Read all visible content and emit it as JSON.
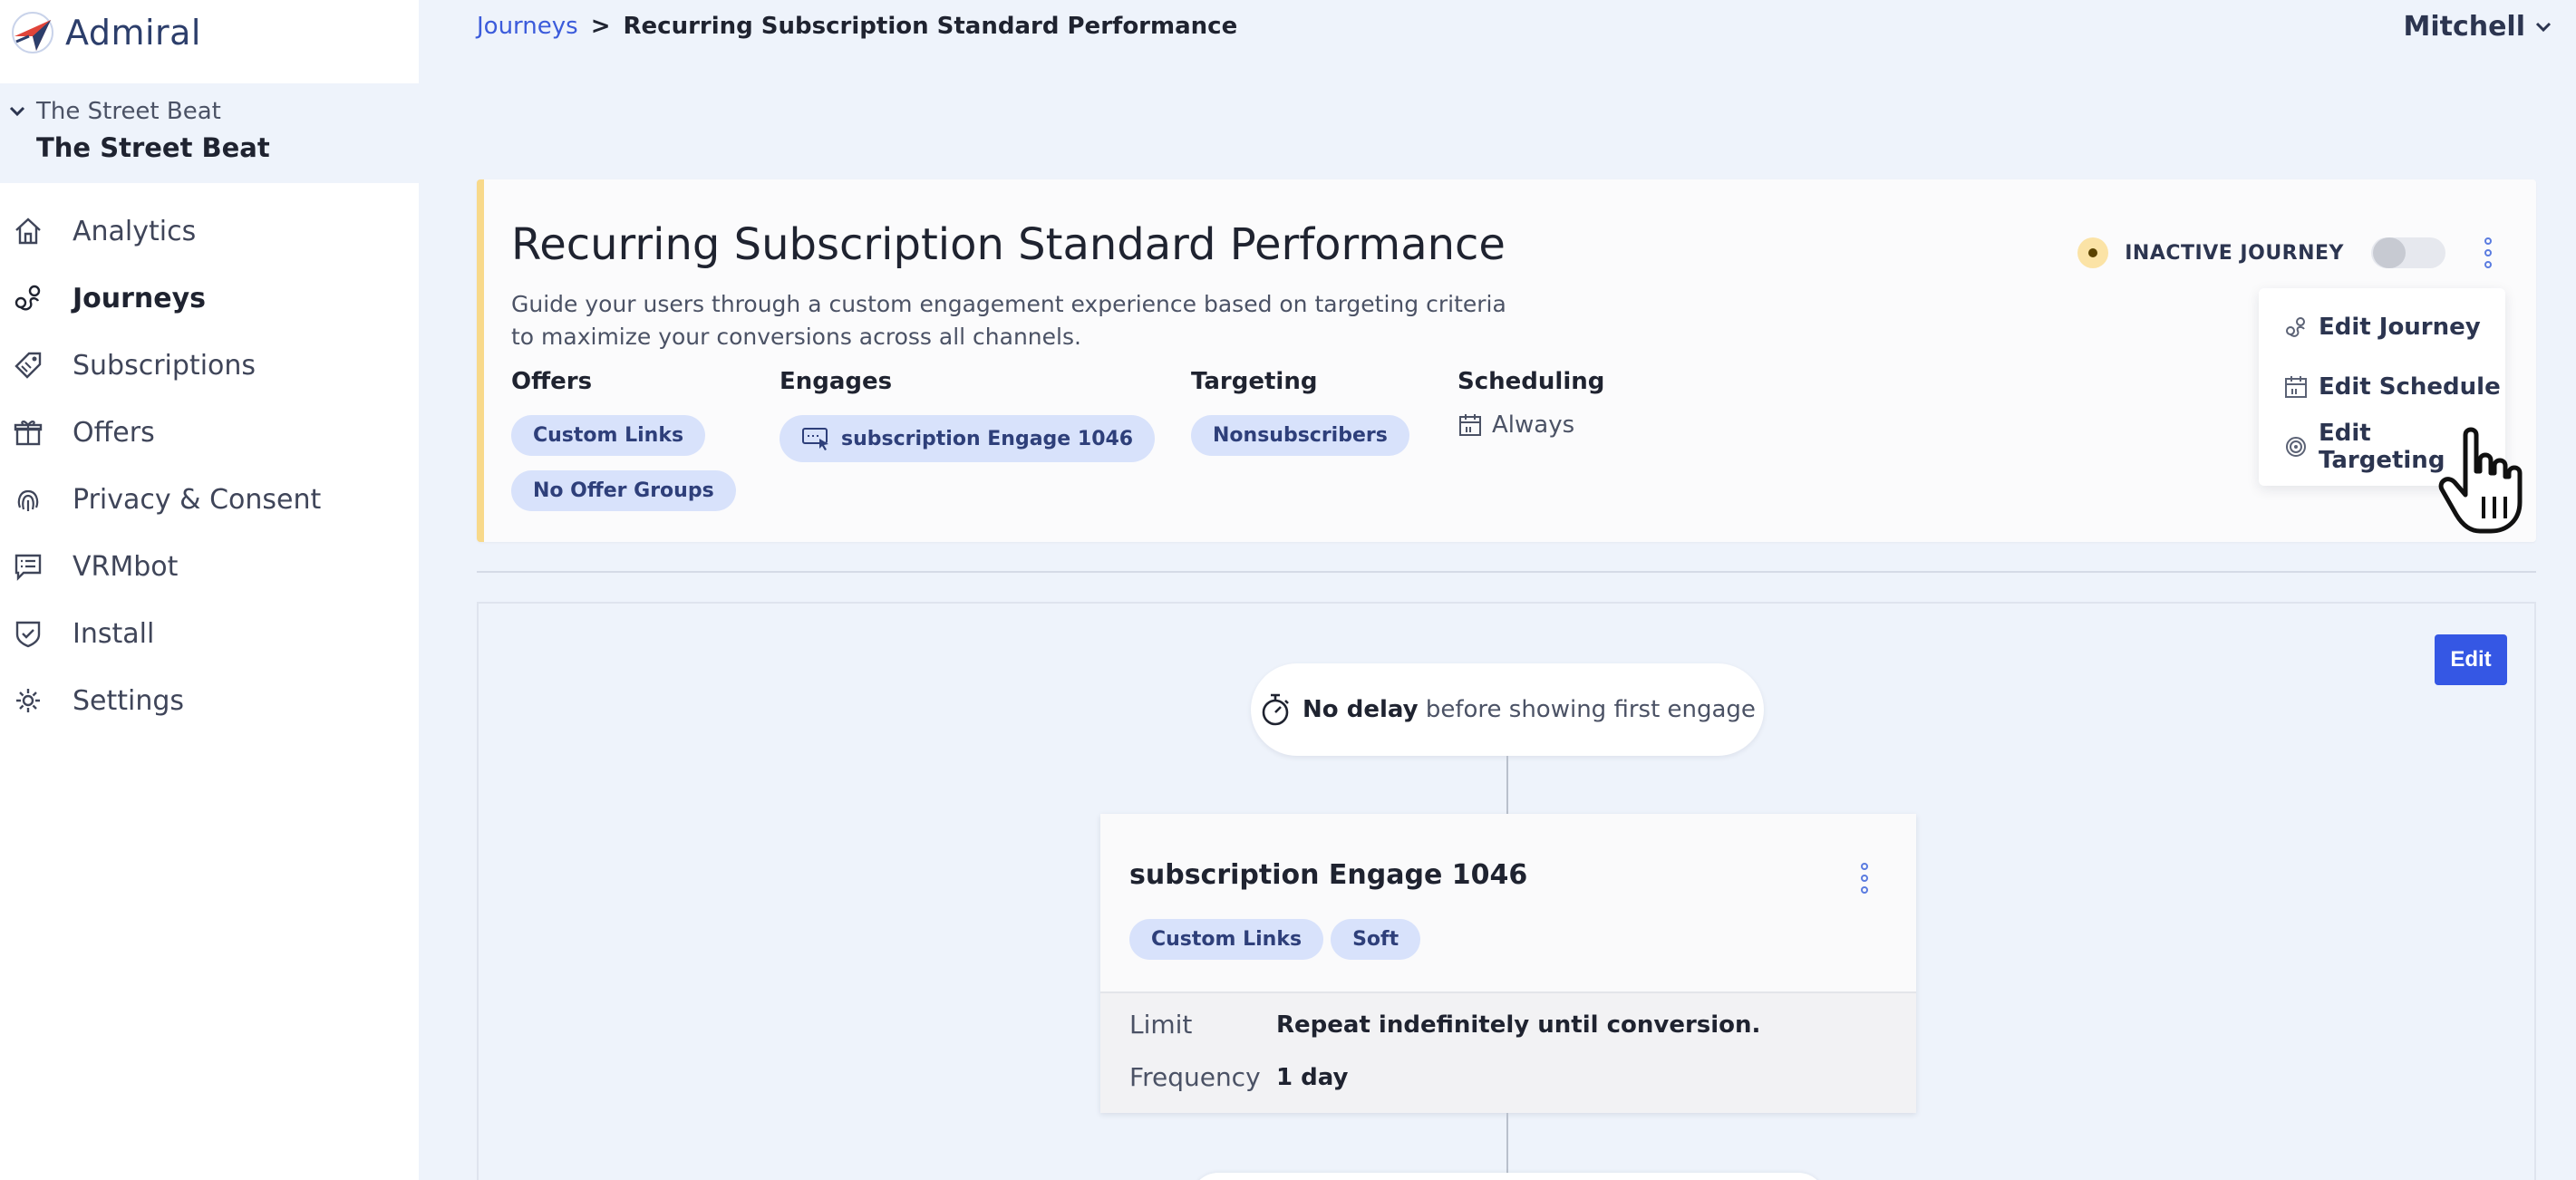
{
  "app": {
    "name": "Admiral"
  },
  "org": {
    "parent": "The Street Beat",
    "current": "The Street Beat"
  },
  "nav": [
    {
      "label": "Analytics",
      "icon": "home-icon"
    },
    {
      "label": "Journeys",
      "icon": "journey-icon",
      "active": true
    },
    {
      "label": "Subscriptions",
      "icon": "tag-icon"
    },
    {
      "label": "Offers",
      "icon": "gift-icon"
    },
    {
      "label": "Privacy & Consent",
      "icon": "fingerprint-icon"
    },
    {
      "label": "VRMbot",
      "icon": "chat-icon"
    },
    {
      "label": "Install",
      "icon": "shield-check-icon"
    },
    {
      "label": "Settings",
      "icon": "gear-icon"
    }
  ],
  "breadcrumb": {
    "parent": "Journeys",
    "separator": ">",
    "current": "Recurring Subscription Standard Performance"
  },
  "user": {
    "name": "Mitchell"
  },
  "journey": {
    "title": "Recurring Subscription Standard Performance",
    "description": "Guide your users through a custom engagement experience based on targeting criteria to maximize your conversions across all channels.",
    "status": "INACTIVE JOURNEY",
    "active": false,
    "offers": {
      "label": "Offers",
      "chips": [
        "Custom Links",
        "No Offer Groups"
      ]
    },
    "engages": {
      "label": "Engages",
      "chips": [
        "subscription Engage 1046"
      ]
    },
    "targeting": {
      "label": "Targeting",
      "chips": [
        "Nonsubscribers"
      ]
    },
    "scheduling": {
      "label": "Scheduling",
      "value": "Always"
    }
  },
  "menu": {
    "items": [
      "Edit Journey",
      "Edit Schedule",
      "Edit Targeting"
    ]
  },
  "flow": {
    "edit_label": "Edit",
    "delay_bold": "No delay",
    "delay_rest": "before showing first engage",
    "engage": {
      "title": "subscription Engage 1046",
      "chips": [
        "Custom Links",
        "Soft"
      ],
      "limit_label": "Limit",
      "limit_value": "Repeat indefinitely until conversion.",
      "frequency_label": "Frequency",
      "frequency_value": "1 day"
    }
  },
  "colors": {
    "accent": "#3557e4",
    "chip_bg": "#d8e2fb",
    "status_bg": "#fbe3a6",
    "card_border": "#f8d98a"
  }
}
